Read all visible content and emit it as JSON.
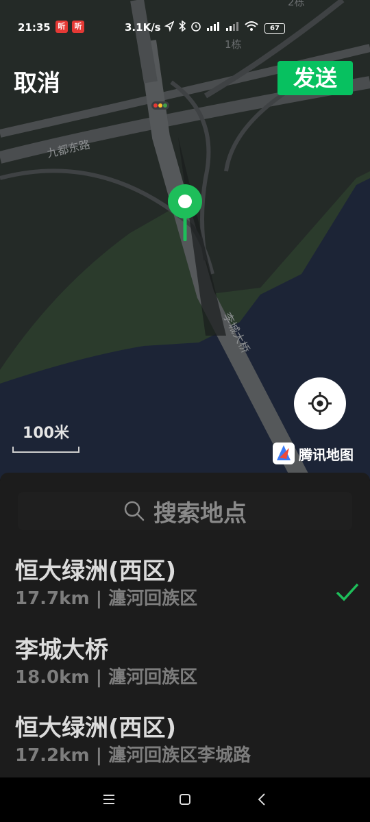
{
  "status_bar": {
    "time": "21:35",
    "badge1": "听",
    "badge2": "听",
    "network_speed": "3.1K/s",
    "battery": "67"
  },
  "header": {
    "cancel_label": "取消",
    "send_label": "发送"
  },
  "map": {
    "labels": {
      "road_1": "九都东路",
      "bridge": "李城大桥",
      "building_1": "1栋",
      "building_2": "2栋"
    },
    "scale_label": "100米",
    "provider": "腾讯地图",
    "colors": {
      "land": "#242a27",
      "water": "#1c2436",
      "green": "#2b3b2c",
      "pin": "#1ebe5a"
    }
  },
  "sheet": {
    "search_placeholder": "搜索地点",
    "results": [
      {
        "title": "恒大绿洲(西区)",
        "subtitle": "17.7km | 瀍河回族区",
        "selected": true
      },
      {
        "title": "李城大桥",
        "subtitle": "18.0km | 瀍河回族区",
        "selected": false
      },
      {
        "title": "恒大绿洲(西区)",
        "subtitle": "17.2km | 瀍河回族区李城路",
        "selected": false
      }
    ]
  },
  "nav_bar": {
    "icons": [
      "menu-icon",
      "home-icon",
      "back-icon"
    ]
  }
}
